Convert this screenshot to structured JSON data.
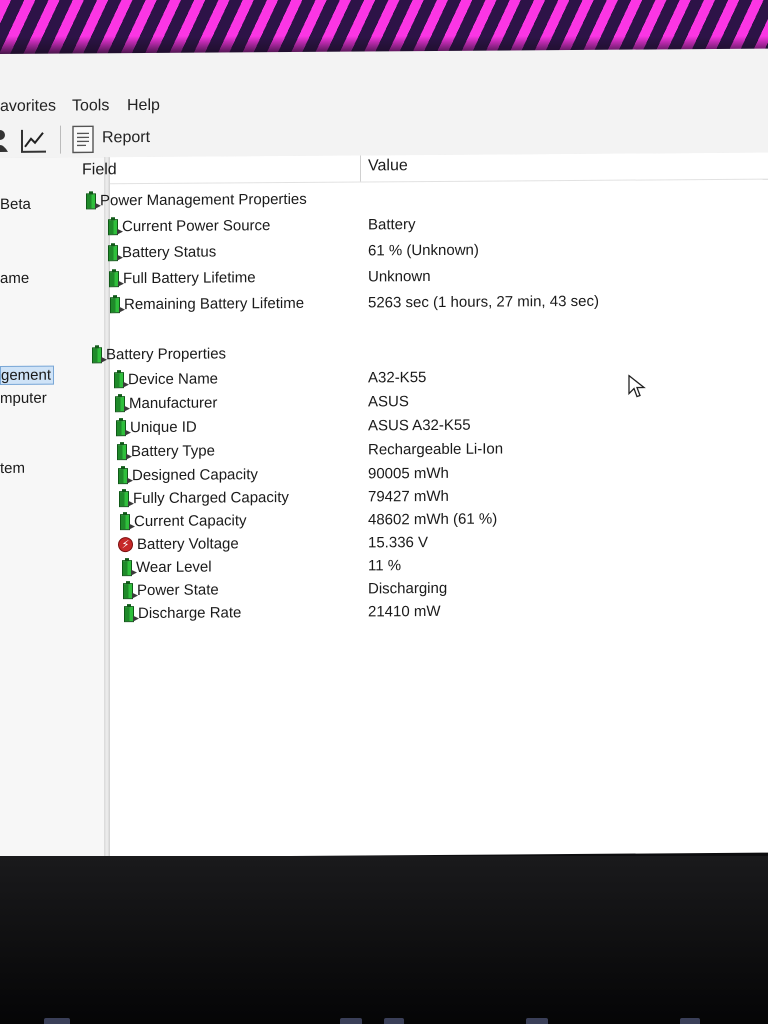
{
  "menu": {
    "favorites": "avorites",
    "tools": "Tools",
    "help": "Help"
  },
  "toolbar": {
    "report_label": "Report",
    "icons": [
      "user-icon",
      "chart-icon",
      "report-icon"
    ]
  },
  "left_tree": {
    "items": [
      {
        "label": "Beta"
      },
      {
        "label": "ame"
      },
      {
        "label": "gement",
        "selected": true
      },
      {
        "label": "mputer"
      },
      {
        "label": "tem"
      }
    ]
  },
  "columns": {
    "field": "Field",
    "value": "Value"
  },
  "sections": [
    {
      "title": "Power Management Properties",
      "rows": [
        {
          "field": "Current Power Source",
          "value": "Battery",
          "icon": "battery-icon"
        },
        {
          "field": "Battery Status",
          "value": "61 % (Unknown)",
          "icon": "battery-icon"
        },
        {
          "field": "Full Battery Lifetime",
          "value": "Unknown",
          "icon": "battery-icon"
        },
        {
          "field": "Remaining Battery Lifetime",
          "value": "5263 sec (1 hours, 27 min, 43 sec)",
          "icon": "battery-icon"
        }
      ]
    },
    {
      "title": "Battery Properties",
      "rows": [
        {
          "field": "Device Name",
          "value": "A32-K55",
          "icon": "battery-icon"
        },
        {
          "field": "Manufacturer",
          "value": "ASUS",
          "icon": "battery-icon"
        },
        {
          "field": "Unique ID",
          "value": "ASUS A32-K55",
          "icon": "battery-icon"
        },
        {
          "field": "Battery Type",
          "value": "Rechargeable Li-Ion",
          "icon": "battery-icon"
        },
        {
          "field": "Designed Capacity",
          "value": "90005 mWh",
          "icon": "battery-icon"
        },
        {
          "field": "Fully Charged Capacity",
          "value": "79427 mWh",
          "icon": "battery-icon"
        },
        {
          "field": "Current Capacity",
          "value": "48602 mWh  (61 %)",
          "icon": "battery-icon"
        },
        {
          "field": "Battery Voltage",
          "value": "15.336 V",
          "icon": "voltage-icon"
        },
        {
          "field": "Wear Level",
          "value": "11 %",
          "icon": "battery-icon"
        },
        {
          "field": "Power State",
          "value": "Discharging",
          "icon": "battery-icon"
        },
        {
          "field": "Discharge Rate",
          "value": "21410 mW",
          "icon": "battery-icon"
        }
      ]
    }
  ],
  "colors": {
    "battery_green": "#2fbf3c",
    "selection_bg": "#cfe3f7",
    "voltage_red": "#c62828"
  }
}
